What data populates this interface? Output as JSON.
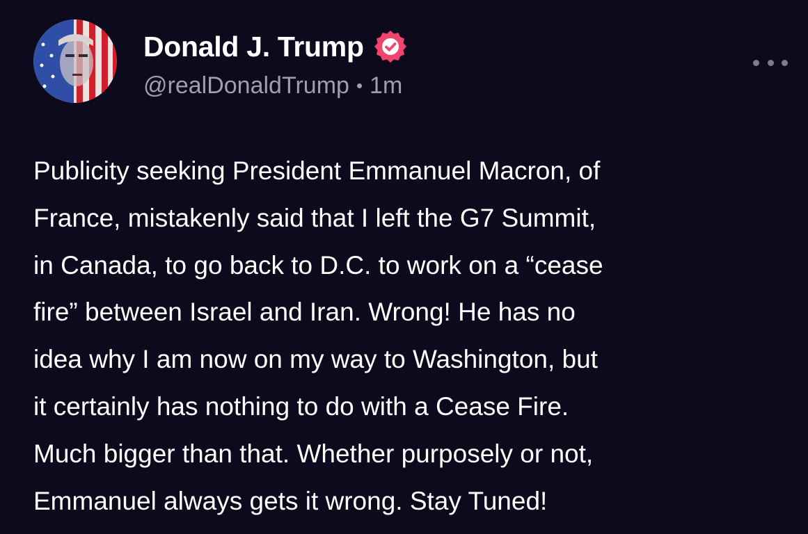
{
  "post": {
    "author": {
      "display_name": "Donald J. Trump",
      "handle": "@realDonaldTrump",
      "avatar_icon": "flag-portrait-avatar",
      "verified_icon": "verified-badge-icon",
      "verified_color": "#f0446d"
    },
    "separator": "•",
    "timestamp": "1m",
    "more_icon": "more-options-icon",
    "body_lines": [
      "Publicity seeking President Emmanuel Macron, of",
      "France, mistakenly said that I left the G7 Summit,",
      "in Canada, to go back to D.C. to work on a “cease",
      "fire” between Israel and Iran. Wrong! He has no",
      "idea why I am now on my way to Washington, but",
      "it certainly has nothing to do with a Cease Fire.",
      "Much bigger than that. Whether purposely or not,",
      "Emmanuel always gets it wrong. Stay Tuned!"
    ]
  },
  "colors": {
    "background": "#0c0a1c",
    "text": "#ffffff",
    "secondary_text": "#a19fae"
  }
}
